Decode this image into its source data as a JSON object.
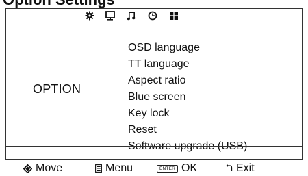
{
  "header": {
    "title": "Option Settings"
  },
  "tabs": [
    {
      "name": "option",
      "icon": "gear-icon",
      "active": true
    },
    {
      "name": "picture",
      "icon": "monitor-icon",
      "active": false
    },
    {
      "name": "sound",
      "icon": "music-note-icon",
      "active": false
    },
    {
      "name": "time",
      "icon": "clock-icon",
      "active": false
    },
    {
      "name": "channel",
      "icon": "grid-icon",
      "active": false
    }
  ],
  "main": {
    "category_label": "OPTION",
    "items": [
      "OSD language",
      "TT language",
      "Aspect ratio",
      "Blue screen",
      "Key lock",
      "Reset",
      "Software upgrade (USB)"
    ]
  },
  "footer": {
    "move": {
      "icon": "diamond-arrows-icon",
      "label": "Move"
    },
    "menu": {
      "icon": "menu-key-icon",
      "label": "Menu"
    },
    "ok": {
      "icon": "enter-key-icon",
      "key_text": "ENTER",
      "label": "OK"
    },
    "exit": {
      "icon": "return-arrow-icon",
      "label": "Exit"
    }
  }
}
